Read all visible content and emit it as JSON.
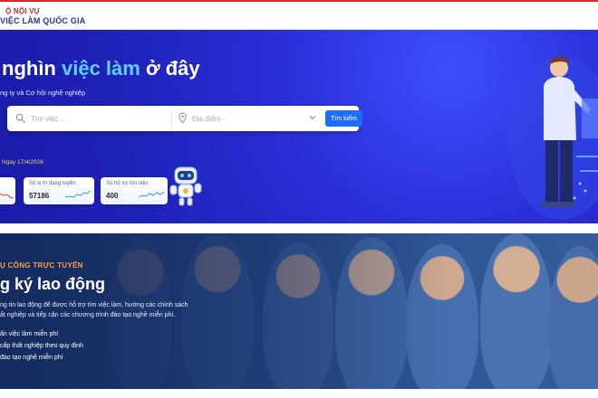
{
  "header": {
    "brand_top": "Ộ NỘI VỤ",
    "brand_bottom": "VIỆC LÀM QUỐC GIA"
  },
  "hero": {
    "title_part1": " nghìn ",
    "title_highlight": "việc làm",
    "title_part2": " ở đây",
    "subtitle": "ng ty và Cơ hội nghề nghiệp",
    "keyword_placeholder": "Tìm việc ...",
    "location_placeholder": "Địa điểm",
    "search_button": "Tìm kiếm",
    "date_line": "Ngày 17/4/2026",
    "stats": [
      {
        "label": "",
        "value": ""
      },
      {
        "label": "Số vị trí đang tuyển",
        "value": "57186"
      },
      {
        "label": "Số hồ sơ tìm việc",
        "value": "400"
      }
    ]
  },
  "services": {
    "tag": "Ụ CÔNG TRỰC TUYẾN",
    "title": "g ký lao động",
    "desc_line1": "ng tin lao động để được hỗ trợ tìm việc làm, hưởng các chính sách",
    "desc_line2": "ất nghiệp và tiếp cận các chương trình đào tạo nghề miễn phí.",
    "bullets": [
      "ấn việc làm miễn phí",
      "cấp thất nghiệp theo quy định",
      "đào tạo nghề miễn phí"
    ]
  },
  "colors": {
    "hero_bg": "#2a2fd8",
    "highlight": "#5fd0ff",
    "search_button": "#1f6dff",
    "services_tag": "#ff9f43",
    "brand_red": "#c62828",
    "brand_blue": "#1a3a9a"
  },
  "icons": [
    "search-icon",
    "location-pin-icon",
    "chevron-down-icon",
    "robot-mascot",
    "sparkline-icon"
  ]
}
